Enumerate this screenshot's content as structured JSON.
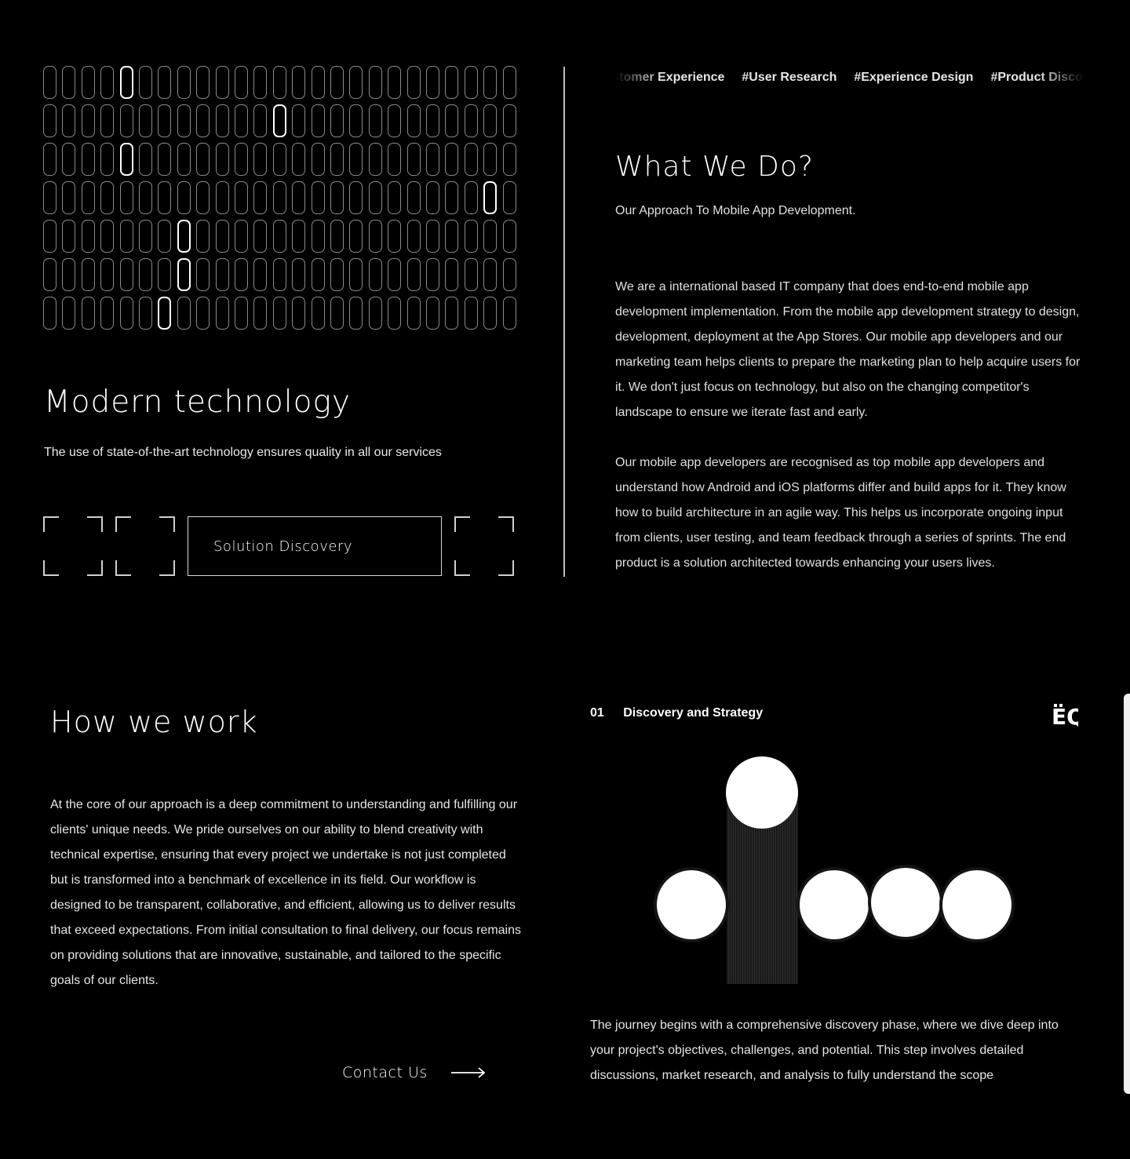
{
  "modern": {
    "title": "Modern technology",
    "subtitle": "The use of state-of-the-art technology ensures quality in all our services",
    "button_label": "Solution Discovery"
  },
  "tags": [
    "#Customer Experience",
    "#User Research",
    "#Experience Design",
    "#Product Discovery"
  ],
  "what_we_do": {
    "title": "What We Do?",
    "subtitle": "Our Approach To Mobile App Development.",
    "paragraph1": "We are a international based IT company that does end-to-end mobile app development implementation. From the mobile app development strategy to design, development, deployment at the App Stores. Our mobile app developers and our marketing team helps clients to prepare the marketing plan to help acquire users for it. We don't just focus on technology, but also on the changing competitor's landscape to ensure we iterate fast and early.",
    "paragraph2": "Our mobile app developers are recognised as top mobile app developers and understand how Android and iOS platforms differ and build apps for it. They know how to build architecture in an agile way. This helps us incorporate ongoing input from clients, user testing, and team feedback through a series of sprints. The end product is a solution architected towards enhancing your users lives."
  },
  "how_we_work": {
    "title": "How we work",
    "paragraph": "At the core of our approach is a deep commitment to understanding and fulfilling our clients' unique needs. We pride ourselves on our ability to blend creativity with technical expertise, ensuring that every project we undertake is not just completed but is transformed into a benchmark of excellence in its field. Our workflow is designed to be transparent, collaborative, and efficient, allowing us to deliver results that exceed expectations. From initial consultation to final delivery, our focus remains on providing solutions that are innovative, sustainable, and tailored to the specific goals of our clients.",
    "contact_label": "Contact Us"
  },
  "step": {
    "number": "01",
    "title": "Discovery and Strategy",
    "paragraph": "The journey begins with a comprehensive discovery phase, where we dive deep into your project's objectives, challenges, and potential. This step involves detailed discussions, market research, and analysis to fully understand the scope",
    "logo_text": "ËĶ"
  },
  "icons": {
    "arrow": "arrow-right-icon",
    "logo": "brand-logo-icon"
  },
  "colors": {
    "background": "#000000",
    "text": "#ffffff",
    "muted_border": "#8a8a8a"
  }
}
